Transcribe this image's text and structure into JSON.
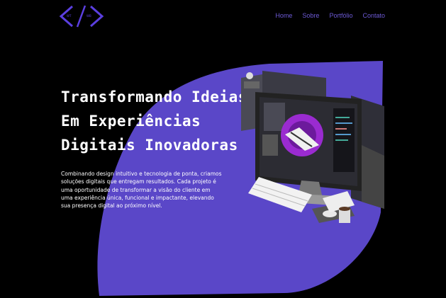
{
  "header": {
    "logo_icon": "code-brackets-icon",
    "nav": [
      "Home",
      "Sobre",
      "Portfólio",
      "Contato"
    ]
  },
  "hero": {
    "title_lines": [
      "Transformando Ideias",
      "Em Experiências",
      "Digitais Inovadoras"
    ],
    "description": "Combinando design intuitivo e tecnologia de ponta, criamos soluções digitais que entregam resultados. Cada projeto é uma oportunidade de transformar a visão do cliente em uma experiência única, funcional e impactante, elevando sua presença digital ao próximo nível.",
    "illustration": "computer-workstation-illustration"
  },
  "colors": {
    "background": "#000000",
    "accent": "#5a47c8",
    "nav_text": "#6d5ad6",
    "logo": "#5b3fe0"
  }
}
